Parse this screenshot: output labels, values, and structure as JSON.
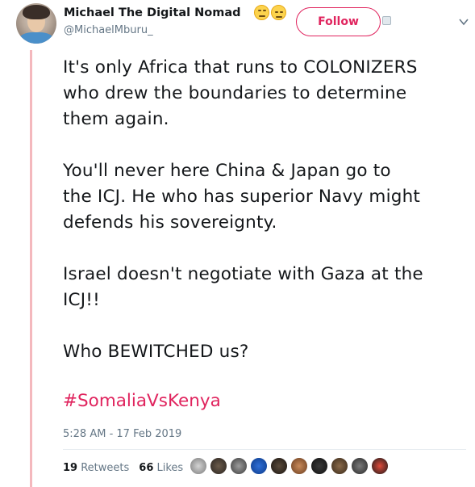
{
  "user": {
    "name": "Michael The Digital Nomad",
    "handle": "@MichaelMburu_"
  },
  "actions": {
    "follow_label": "Follow"
  },
  "tweet": {
    "paragraphs": [
      "It's only Africa that runs to COLONIZERS\nwho drew the boundaries to determine\nthem again.",
      "You'll never here China & Japan go to\nthe ICJ. He who has superior Navy might\ndefends his sovereignty.",
      "Israel doesn't negotiate with Gaza at the\nICJ!!",
      "Who BEWITCHED us?"
    ],
    "hashtag": "#SomaliaVsKenya",
    "timestamp": "5:28 AM - 17 Feb 2019"
  },
  "stats": {
    "retweets_count": "19",
    "retweets_label": "Retweets",
    "likes_count": "66",
    "likes_label": "Likes"
  },
  "colors": {
    "accent": "#e0245e",
    "thread_line": "#f4b8bd",
    "muted": "#657786"
  },
  "icons": {
    "emoji_1": "face-with-rolling-eyes",
    "emoji_2": "unamused-face",
    "liker_avatars": [
      "liker-avatar-1",
      "liker-avatar-2",
      "liker-avatar-3",
      "liker-avatar-4",
      "liker-avatar-5",
      "liker-avatar-6",
      "liker-avatar-7",
      "liker-avatar-8",
      "liker-avatar-9",
      "liker-avatar-10"
    ]
  }
}
